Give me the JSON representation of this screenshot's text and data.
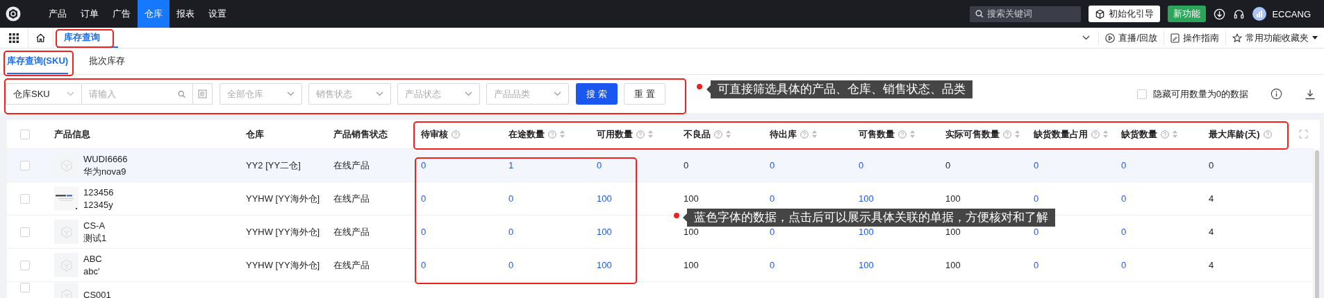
{
  "top_menu": [
    {
      "label": "产品",
      "selected": false
    },
    {
      "label": "订单",
      "selected": false
    },
    {
      "label": "广告",
      "selected": false
    },
    {
      "label": "仓库",
      "selected": true
    },
    {
      "label": "报表",
      "selected": false
    },
    {
      "label": "设置",
      "selected": false
    }
  ],
  "search": {
    "placeholder": "搜索关键词"
  },
  "guide_button": "初始化引导",
  "new_button": "新功能",
  "user": "ECCANG",
  "page_tabs": [
    {
      "label": "库存查询",
      "selected": true
    }
  ],
  "toolbar_links": [
    "直播/回放",
    "操作指南",
    "常用功能收藏夹"
  ],
  "sub_tabs": [
    {
      "label": "库存查询(SKU)",
      "selected": true
    },
    {
      "label": "批次库存",
      "selected": false
    }
  ],
  "filters": {
    "field_select": "仓库SKU",
    "keyword": {
      "placeholder": "请输入"
    },
    "selects": [
      {
        "placeholder": "全部仓库"
      },
      {
        "placeholder": "销售状态"
      },
      {
        "placeholder": "产品状态"
      },
      {
        "placeholder": "产品品类"
      }
    ],
    "search_button": "搜 索",
    "reset_button": "重 置",
    "hide_zero": {
      "label": "隐藏可用数量为0的数据",
      "checked": false
    }
  },
  "table": {
    "select_all": false,
    "columns": [
      {
        "label": "产品信息",
        "help": false,
        "sortable": false
      },
      {
        "label": "仓库",
        "help": false,
        "sortable": false
      },
      {
        "label": "产品销售状态",
        "help": false,
        "sortable": false
      },
      {
        "label": "待审核",
        "help": true,
        "sortable": false,
        "link": true
      },
      {
        "label": "在途数量",
        "help": true,
        "sortable": true,
        "link": true
      },
      {
        "label": "可用数量",
        "help": true,
        "sortable": true,
        "link": true
      },
      {
        "label": "不良品",
        "help": true,
        "sortable": true,
        "link": false
      },
      {
        "label": "待出库",
        "help": true,
        "sortable": true,
        "link": true
      },
      {
        "label": "可售数量",
        "help": true,
        "sortable": true,
        "link": true
      },
      {
        "label": "实际可售数量",
        "help": true,
        "sortable": true,
        "link": false
      },
      {
        "label": "缺货数量占用",
        "help": true,
        "sortable": true,
        "link": true
      },
      {
        "label": "缺货数量",
        "help": true,
        "sortable": true,
        "link": true
      },
      {
        "label": "最大库龄(天)",
        "help": true,
        "sortable": false,
        "link": false
      }
    ],
    "rows": [
      {
        "checked": false,
        "selected": true,
        "thumbnail": {
          "kind": "placeholder"
        },
        "sku": "WUDI6666",
        "name": "华为nova9",
        "warehouse": "YY2 [YY二仓]",
        "status": "在线产品",
        "values": [
          "0",
          "1",
          "0",
          "0",
          "0",
          "0",
          "0",
          "0",
          "0",
          "0"
        ]
      },
      {
        "checked": false,
        "selected": false,
        "sku": "123456",
        "name": "12345y",
        "warehouse": "YYHW [YY海外仓]",
        "status": "在线产品",
        "values": [
          "0",
          "0",
          "100",
          "100",
          "0",
          "100",
          "100",
          "0",
          "0",
          "4"
        ]
      },
      {
        "checked": false,
        "selected": false,
        "thumbnail": {
          "kind": "placeholder"
        },
        "sku": "CS-A",
        "name": "测试1",
        "warehouse": "YYHW [YY海外仓]",
        "status": "在线产品",
        "values": [
          "0",
          "0",
          "100",
          "100",
          "0",
          "100",
          "100",
          "0",
          "0",
          "4"
        ]
      },
      {
        "checked": false,
        "selected": false,
        "thumbnail": {
          "kind": "placeholder"
        },
        "sku": "ABC",
        "name": "abc'",
        "warehouse": "YYHW [YY海外仓]",
        "status": "在线产品",
        "values": [
          "0",
          "0",
          "100",
          "100",
          "0",
          "100",
          "100",
          "0",
          "0",
          "4"
        ]
      },
      {
        "checked": false,
        "selected": false,
        "thumbnail": {
          "kind": "placeholder"
        },
        "sku": "CS001"
      }
    ]
  },
  "callouts": [
    {
      "text": "可直接筛选具体的产品、仓库、销售状态、品类"
    },
    {
      "text": "蓝色字体的数据，点击后可以展示具体关联的单据，方便核对和了解"
    }
  ]
}
